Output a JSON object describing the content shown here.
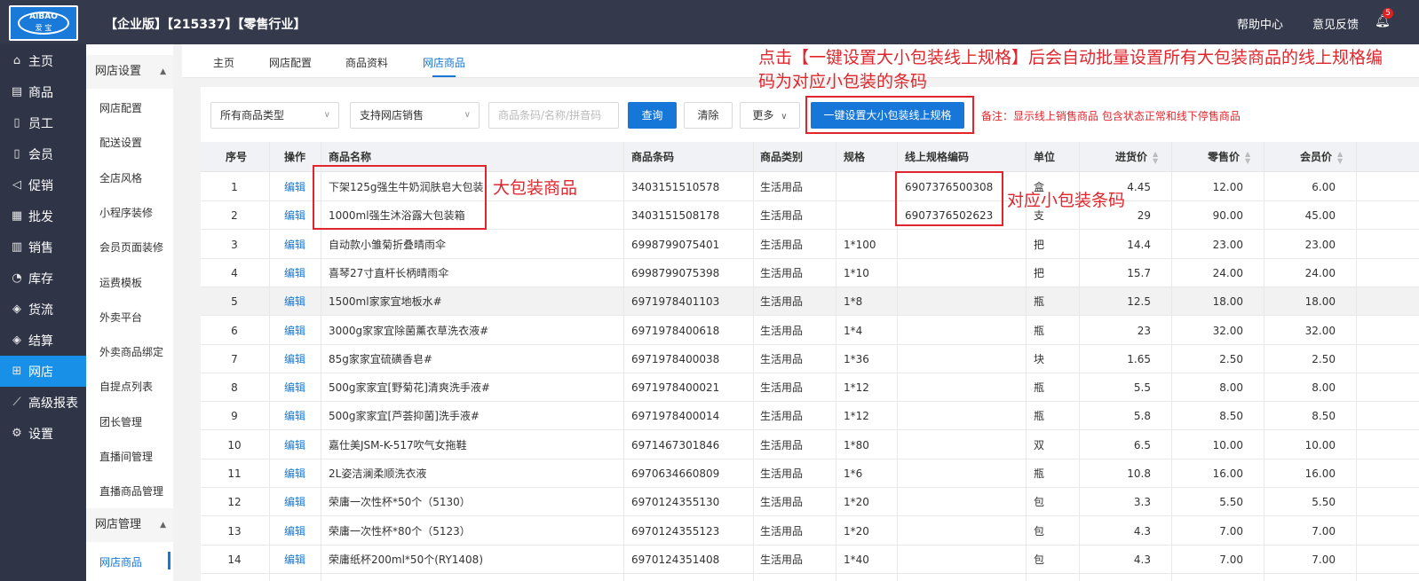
{
  "header": {
    "title": "【企业版】【215337】【零售行业】",
    "logo_brand": "AIBAO",
    "logo_sub": "爱 宝",
    "help_label": "帮助中心",
    "feedback_label": "意见反馈",
    "notification_count": "5"
  },
  "sidebar": {
    "items": [
      {
        "label": "主页",
        "icon": "home-icon",
        "glyph": "⌂"
      },
      {
        "label": "商品",
        "icon": "goods-icon",
        "glyph": "▤"
      },
      {
        "label": "员工",
        "icon": "staff-icon",
        "glyph": "▯"
      },
      {
        "label": "会员",
        "icon": "member-icon",
        "glyph": "▯"
      },
      {
        "label": "促销",
        "icon": "promotion-icon",
        "glyph": "◁"
      },
      {
        "label": "批发",
        "icon": "wholesale-icon",
        "glyph": "▦"
      },
      {
        "label": "销售",
        "icon": "sales-icon",
        "glyph": "▥"
      },
      {
        "label": "库存",
        "icon": "inventory-icon",
        "glyph": "◔"
      },
      {
        "label": "货流",
        "icon": "logistics-icon",
        "glyph": "◈"
      },
      {
        "label": "结算",
        "icon": "settlement-icon",
        "glyph": "◈"
      },
      {
        "label": "网店",
        "icon": "store-icon",
        "glyph": "⊞"
      },
      {
        "label": "高级报表",
        "icon": "report-icon",
        "glyph": "⟋"
      },
      {
        "label": "设置",
        "icon": "settings-icon",
        "glyph": "⚙"
      }
    ],
    "active_index": 10
  },
  "submenu": {
    "group1": "网店设置",
    "group1_items": [
      "网店配置",
      "配送设置",
      "全店风格",
      "小程序装修",
      "会员页面装修",
      "运费模板",
      "外卖平台",
      "外卖商品绑定",
      "自提点列表",
      "团长管理",
      "直播间管理",
      "直播商品管理"
    ],
    "group2": "网店管理",
    "group2_items": [
      "网店商品"
    ]
  },
  "tabs": [
    "主页",
    "网店配置",
    "商品资料",
    "网店商品"
  ],
  "active_tab": 3,
  "filters": {
    "type_select": "所有商品类型",
    "sale_select": "支持网店销售",
    "search_placeholder": "商品条码/名称/拼音码",
    "query_label": "查询",
    "clear_label": "清除",
    "more_label": "更多",
    "batch_label": "一键设置大小包装线上规格",
    "note": "备注：显示线上销售商品 包含状态正常和线下停售商品"
  },
  "annotations": {
    "top": "点击【一键设置大小包装线上规格】后会自动批量设置所有大包装商品的线上规格编码为对应小包装的条码",
    "big_pack": "大包装商品",
    "small_pack": "对应小包装条码"
  },
  "table": {
    "columns": [
      "序号",
      "操作",
      "商品名称",
      "商品条码",
      "商品类别",
      "规格",
      "线上规格编码",
      "单位",
      "进货价",
      "零售价",
      "会员价"
    ],
    "edit_label": "编辑",
    "rows": [
      [
        "1",
        "下架125g强生牛奶润肤皂大包装",
        "3403151510578",
        "生活用品",
        "",
        "6907376500308",
        "盒",
        "4.45",
        "12.00",
        "6.00"
      ],
      [
        "2",
        "1000ml强生沐浴露大包装箱",
        "3403151508178",
        "生活用品",
        "",
        "6907376502623",
        "支",
        "29",
        "90.00",
        "45.00"
      ],
      [
        "3",
        "自动款小雏菊折叠晴雨伞",
        "6998799075401",
        "生活用品",
        "1*100",
        "",
        "把",
        "14.4",
        "23.00",
        "23.00"
      ],
      [
        "4",
        "喜琴27寸直杆长柄晴雨伞",
        "6998799075398",
        "生活用品",
        "1*10",
        "",
        "把",
        "15.7",
        "24.00",
        "24.00"
      ],
      [
        "5",
        "1500ml家家宜地板水#",
        "6971978401103",
        "生活用品",
        "1*8",
        "",
        "瓶",
        "12.5",
        "18.00",
        "18.00"
      ],
      [
        "6",
        "3000g家家宜除菌薰衣草洗衣液#",
        "6971978400618",
        "生活用品",
        "1*4",
        "",
        "瓶",
        "23",
        "32.00",
        "32.00"
      ],
      [
        "7",
        "85g家家宜硫磺香皂#",
        "6971978400038",
        "生活用品",
        "1*36",
        "",
        "块",
        "1.65",
        "2.50",
        "2.50"
      ],
      [
        "8",
        "500g家家宜[野菊花]清爽洗手液#",
        "6971978400021",
        "生活用品",
        "1*12",
        "",
        "瓶",
        "5.5",
        "8.00",
        "8.00"
      ],
      [
        "9",
        "500g家家宜[芦荟抑菌]洗手液#",
        "6971978400014",
        "生活用品",
        "1*12",
        "",
        "瓶",
        "5.8",
        "8.50",
        "8.50"
      ],
      [
        "10",
        "嘉仕美JSM-K-517吹气女拖鞋",
        "6971467301846",
        "生活用品",
        "1*80",
        "",
        "双",
        "6.5",
        "10.00",
        "10.00"
      ],
      [
        "11",
        "2L姿洁澜柔顺洗衣液",
        "6970634660809",
        "生活用品",
        "1*6",
        "",
        "瓶",
        "10.8",
        "16.00",
        "16.00"
      ],
      [
        "12",
        "荣庸一次性杯*50个（5130）",
        "6970124355130",
        "生活用品",
        "1*20",
        "",
        "包",
        "3.3",
        "5.50",
        "5.50"
      ],
      [
        "13",
        "荣庸一次性杯*80个（5123）",
        "6970124355123",
        "生活用品",
        "1*20",
        "",
        "包",
        "4.3",
        "7.00",
        "7.00"
      ],
      [
        "14",
        "荣庸纸杯200ml*50个(RY1408)",
        "6970124351408",
        "生活用品",
        "1*40",
        "",
        "包",
        "4.3",
        "7.00",
        "7.00"
      ]
    ]
  },
  "colors": {
    "accent": "#1677d8",
    "annotation": "#e0262c",
    "topbar": "#343a4b",
    "sidebar": "#2f3447"
  }
}
